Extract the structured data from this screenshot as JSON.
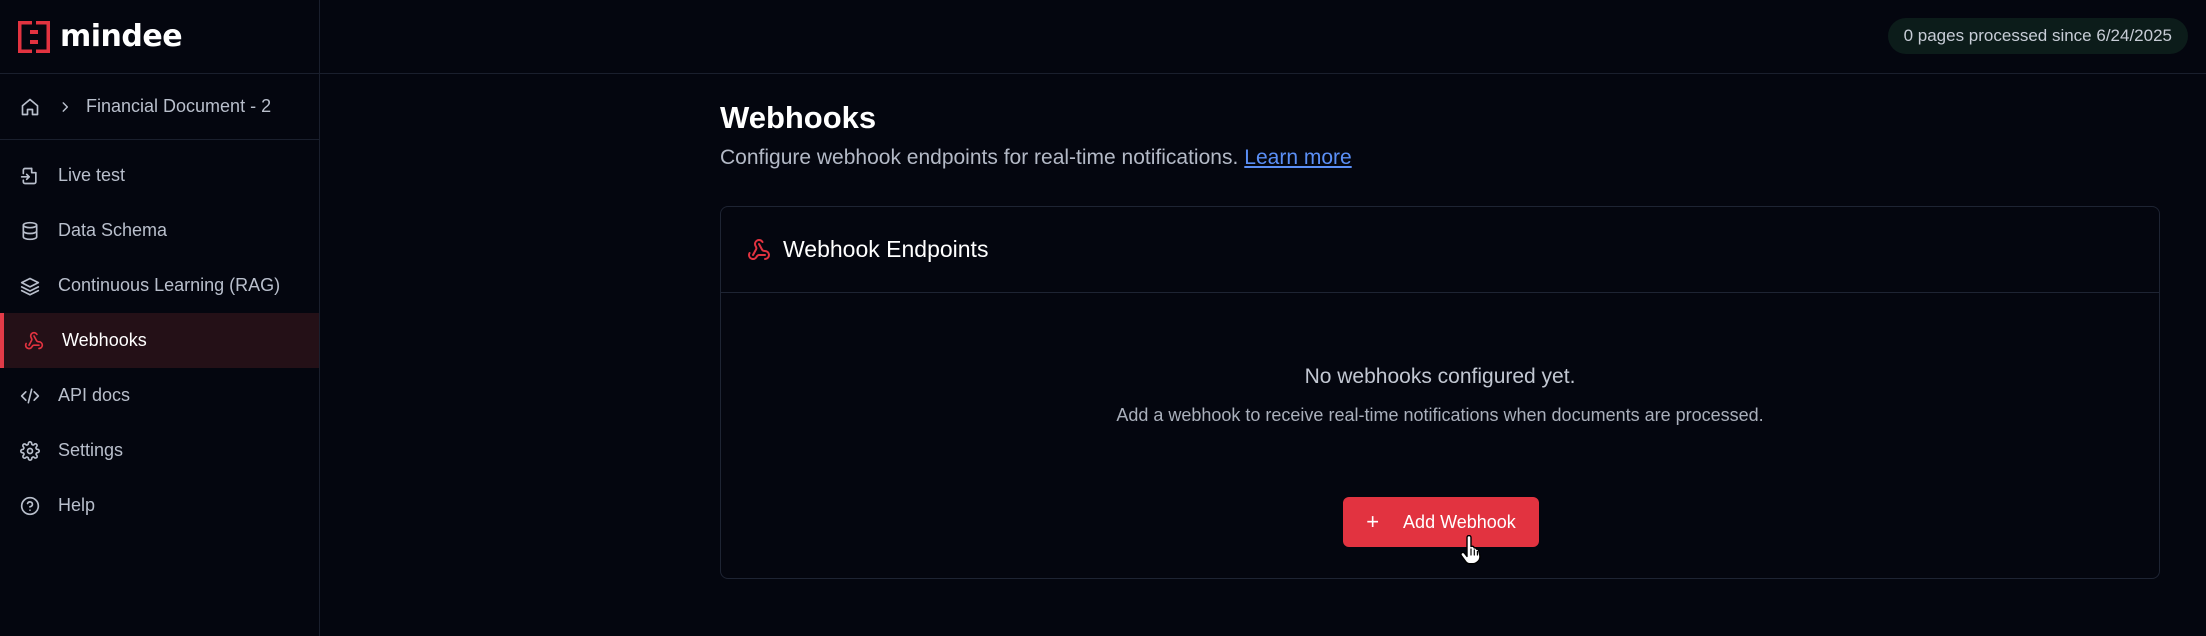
{
  "app": {
    "logo_text": "mindee",
    "brand_color": "#e23340"
  },
  "breadcrumb": {
    "home_icon": "home-icon",
    "current": "Financial Document - 2"
  },
  "sidebar": {
    "items": [
      {
        "label": "Live test",
        "icon": "file-import-icon"
      },
      {
        "label": "Data Schema",
        "icon": "database-icon"
      },
      {
        "label": "Continuous Learning (RAG)",
        "icon": "layers-icon"
      },
      {
        "label": "Webhooks",
        "icon": "webhook-icon",
        "active": true
      },
      {
        "label": "API docs",
        "icon": "code-icon"
      },
      {
        "label": "Settings",
        "icon": "gear-icon"
      },
      {
        "label": "Help",
        "icon": "help-circle-icon"
      }
    ]
  },
  "header": {
    "pages_badge": "0 pages processed since 6/24/2025"
  },
  "main": {
    "title": "Webhooks",
    "subtitle": "Configure webhook endpoints for real-time notifications.",
    "learn_more": "Learn more",
    "card": {
      "title": "Webhook Endpoints",
      "empty_title": "No webhooks configured yet.",
      "empty_subtitle": "Add a webhook to receive real-time notifications when documents are processed.",
      "add_button": "Add Webhook"
    }
  }
}
